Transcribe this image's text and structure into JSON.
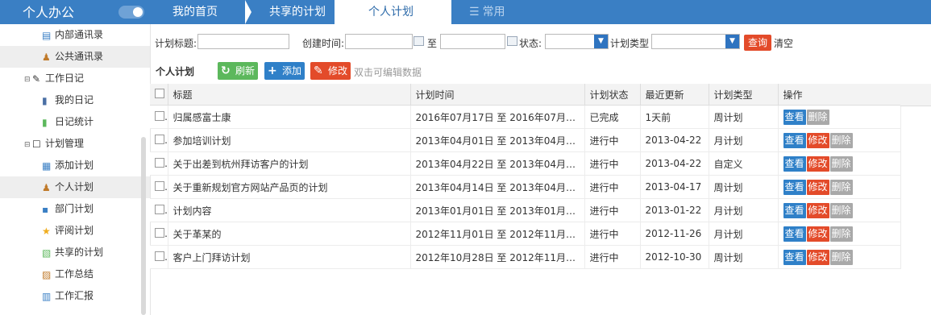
{
  "app": {
    "title": "个人办公"
  },
  "sidebar": {
    "items": [
      {
        "label": "内部通讯录",
        "icon": "contacts-icon",
        "level": 2
      },
      {
        "label": "公共通讯录",
        "icon": "user-group-icon",
        "level": 2,
        "active": true
      },
      {
        "label": "工作日记",
        "icon": "pencil-icon",
        "level": 1,
        "group": true
      },
      {
        "label": "我的日记",
        "icon": "diary-icon",
        "level": 2
      },
      {
        "label": "日记统计",
        "icon": "bar-chart-icon",
        "level": 2
      },
      {
        "label": "计划管理",
        "icon": "edit-box-icon",
        "level": 1,
        "group": true
      },
      {
        "label": "添加计划",
        "icon": "add-plan-icon",
        "level": 2
      },
      {
        "label": "个人计划",
        "icon": "person-icon",
        "level": 2,
        "active": true
      },
      {
        "label": "部门计划",
        "icon": "org-chart-icon",
        "level": 2
      },
      {
        "label": "评阅计划",
        "icon": "star-icon",
        "level": 2
      },
      {
        "label": "共享的计划",
        "icon": "share-icon",
        "level": 2
      },
      {
        "label": "工作总结",
        "icon": "summary-icon",
        "level": 2
      },
      {
        "label": "工作汇报",
        "icon": "report-icon",
        "level": 2
      }
    ]
  },
  "tabs": [
    {
      "label": "我的首页"
    },
    {
      "label": "共享的计划"
    },
    {
      "label": "个人计划",
      "active": true
    },
    {
      "label": "常用",
      "icon": "menu-lines-icon"
    }
  ],
  "filter": {
    "title_label": "计划标题:",
    "created_label": "创建时间:",
    "to_label": "至",
    "status_label": "状态:",
    "type_label": "计划类型",
    "query_label": "查询",
    "clear_label": "清空"
  },
  "toolbar": {
    "title": "个人计划",
    "refresh_label": "刷新",
    "add_label": "添加",
    "edit_label": "修改",
    "hint": "双击可编辑数据"
  },
  "table": {
    "columns": [
      "标题",
      "计划时间",
      "计划状态",
      "最近更新",
      "计划类型",
      "操作"
    ],
    "rows": [
      {
        "title": "归属感富士康",
        "time": "2016年07月17日 至 2016年07月2...",
        "status": "已完成",
        "updated": "1天前",
        "type": "周计划",
        "actions": [
          "查看",
          "删除"
        ]
      },
      {
        "title": "参加培训计划",
        "time": "2013年04月01日 至 2013年04月3...",
        "status": "进行中",
        "updated": "2013-04-22",
        "type": "月计划",
        "actions": [
          "查看",
          "修改",
          "删除"
        ]
      },
      {
        "title": "关于出差到杭州拜访客户的计划",
        "time": "2013年04月22日 至 2013年04月2...",
        "status": "进行中",
        "updated": "2013-04-22",
        "type": "自定义",
        "actions": [
          "查看",
          "修改",
          "删除"
        ]
      },
      {
        "title": "关于重新规划官方网站产品页的计划",
        "time": "2013年04月14日 至 2013年04月2...",
        "status": "进行中",
        "updated": "2013-04-17",
        "type": "周计划",
        "actions": [
          "查看",
          "修改",
          "删除"
        ]
      },
      {
        "title": "计划内容",
        "time": "2013年01月01日 至 2013年01月3...",
        "status": "进行中",
        "updated": "2013-01-22",
        "type": "月计划",
        "actions": [
          "查看",
          "修改",
          "删除"
        ]
      },
      {
        "title": "关于革某的",
        "time": "2012年11月01日 至 2012年11月3...",
        "status": "进行中",
        "updated": "2012-11-26",
        "type": "月计划",
        "actions": [
          "查看",
          "修改",
          "删除"
        ]
      },
      {
        "title": "客户上门拜访计划",
        "time": "2012年10月28日 至 2012年11月0...",
        "status": "进行中",
        "updated": "2012-10-30",
        "type": "周计划",
        "actions": [
          "查看",
          "修改",
          "删除"
        ]
      }
    ]
  },
  "colors": {
    "primary": "#3a7fc4",
    "danger": "#e34b2a",
    "success": "#5cb85c",
    "muted": "#a9a9a9"
  }
}
